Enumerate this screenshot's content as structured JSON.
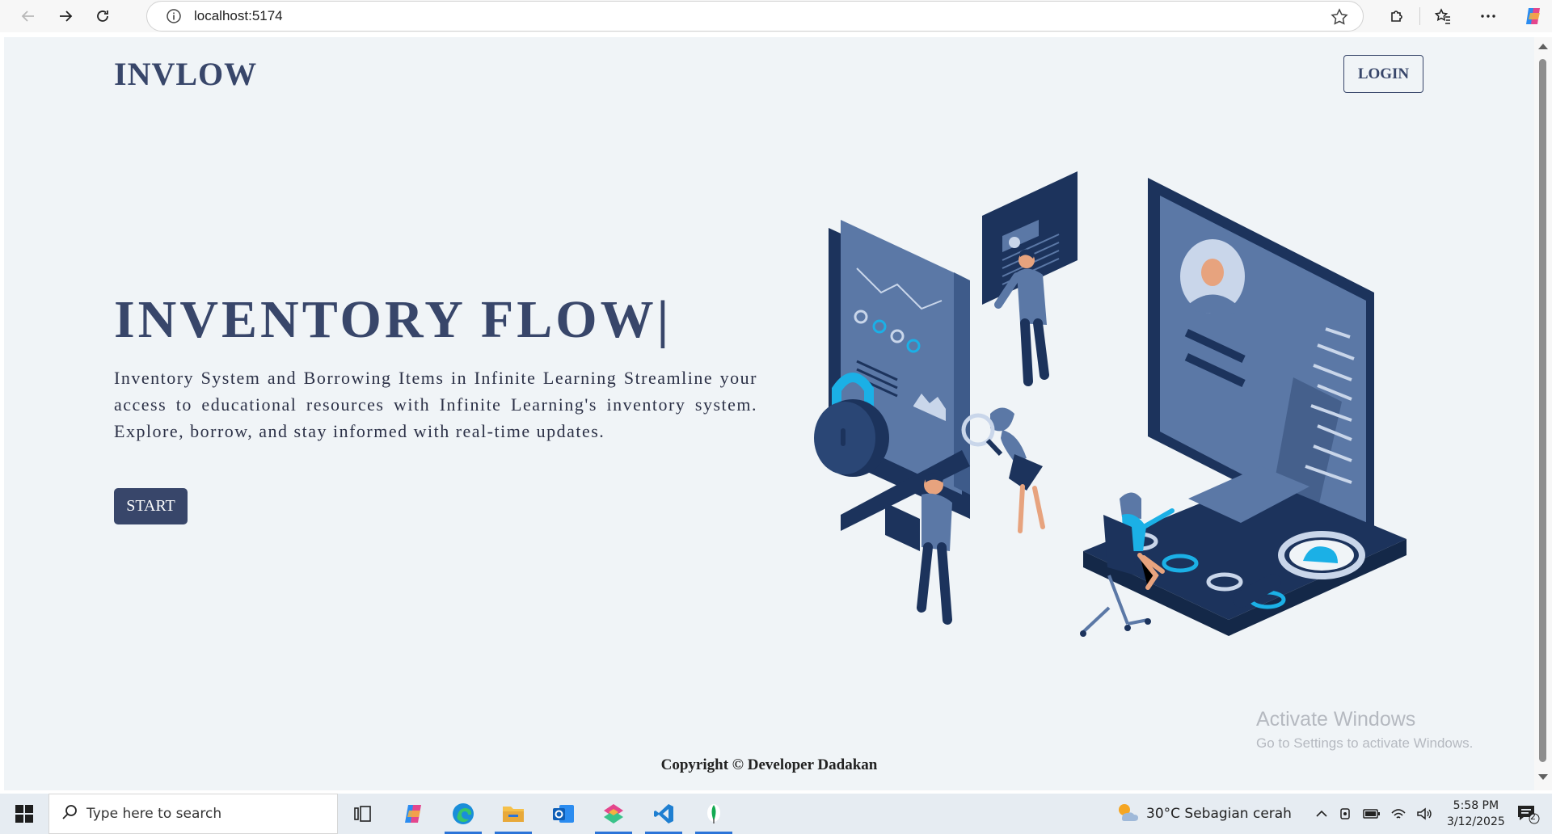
{
  "browser": {
    "url": "localhost:5174"
  },
  "header": {
    "logo": "INVLOW",
    "login_label": "LOGIN"
  },
  "hero": {
    "title": "INVENTORY FLOW|",
    "description": "Inventory System and Borrowing Items in Infinite Learning Streamline your access to educational resources with Infinite Learning's inventory system. Explore, borrow, and stay informed with real-time updates.",
    "start_label": "START"
  },
  "watermark": {
    "line1": "Activate Windows",
    "line2": "Go to Settings to activate Windows."
  },
  "footer": {
    "copyright": "Copyright © Developer Dadakan"
  },
  "taskbar": {
    "search_placeholder": "Type here to search",
    "weather": "30°C  Sebagian cerah",
    "time": "5:58 PM",
    "date": "3/12/2025",
    "notification_count": "2"
  },
  "colors": {
    "brand": "#38466a",
    "page_background": "#f0f4f7",
    "illustration_dark": "#1c335c",
    "illustration_mid": "#5b78a6",
    "illustration_accent": "#1bb0e6"
  }
}
